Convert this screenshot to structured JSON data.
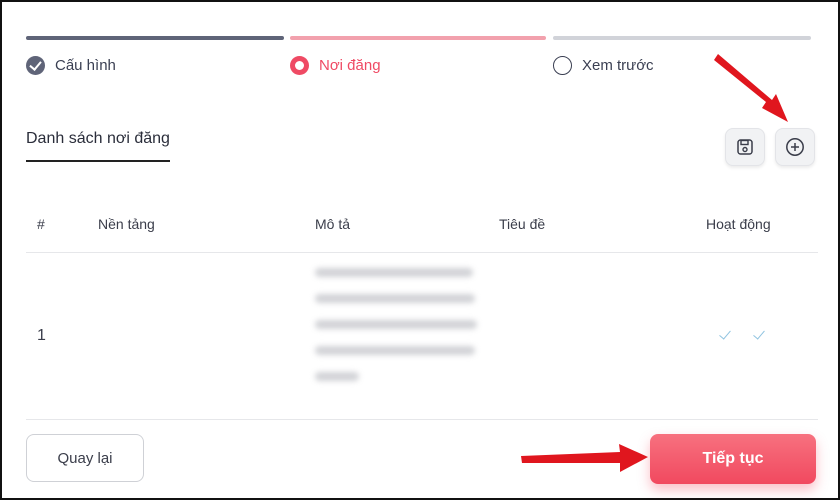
{
  "stepper": {
    "steps": [
      {
        "label": "Cấu hình",
        "state": "done"
      },
      {
        "label": "Nơi đăng",
        "state": "active"
      },
      {
        "label": "Xem trước",
        "state": "pending"
      }
    ]
  },
  "section": {
    "title": "Danh sách nơi đăng"
  },
  "table": {
    "columns": [
      "#",
      "Nền tảng",
      "Mô tả",
      "Tiêu đề",
      "Hoạt động"
    ],
    "rows": [
      {
        "index": "1",
        "platform": "",
        "description": "",
        "title": "",
        "active": [
          "check",
          "check"
        ]
      }
    ]
  },
  "actions": {
    "back_label": "Quay lại",
    "next_label": "Tiếp tục"
  },
  "colors": {
    "accent": "#ef4a64",
    "done": "#5f6478",
    "pending_bar": "#d1d3d9",
    "annotation_arrow": "#e0161e"
  },
  "icons": {
    "save": "save-icon",
    "add": "plus-circle-icon"
  }
}
